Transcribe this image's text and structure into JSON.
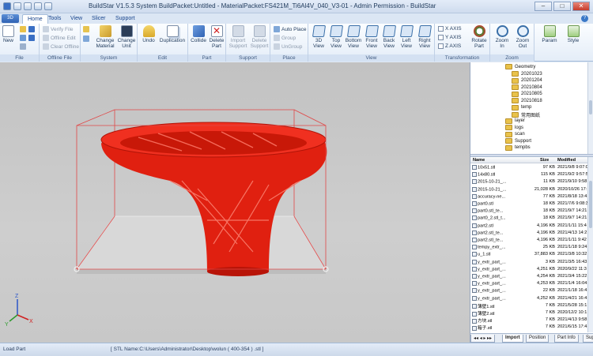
{
  "window": {
    "title": "BuildStar V1.5.3 System    BuildPacket:Untitled - MaterialPacket:FS421M_Ti6Al4V_040_V3-01 - Admin Permission - BuildStar",
    "controls": [
      "–",
      "□",
      "✕"
    ]
  },
  "app_button": "3D",
  "tabs": [
    "Home",
    "Tools",
    "View",
    "Slicer",
    "Support"
  ],
  "help": "?",
  "ribbon": {
    "file": {
      "label": "File",
      "new": "New"
    },
    "offline": {
      "label": "Offline File",
      "verify": "Verify File",
      "edit": "Offline Edit",
      "clear": "Clear Offline"
    },
    "system": {
      "label": "System",
      "change_material": "Change\nMaterial",
      "change_unit": "Change\nUnit"
    },
    "edit": {
      "label": "Edit",
      "undo": "Undo",
      "duplication": "Duplication"
    },
    "part": {
      "label": "Part",
      "collide": "Collide",
      "delete_part": "Delete\nPart"
    },
    "support": {
      "label": "Support",
      "import": "Import\nSupport",
      "delete": "Delete\nSupport"
    },
    "place": {
      "label": "Place",
      "auto": "Auto Place",
      "group": "Group",
      "ungroup": "UnGroup"
    },
    "view": {
      "label": "View",
      "items": [
        "3D\nView",
        "Top\nView",
        "Bottom\nView",
        "Front\nView",
        "Back\nView",
        "Left\nView",
        "Right\nView"
      ]
    },
    "transformation": {
      "label": "Transformation",
      "x_axis": "X AXIS",
      "y_axis": "Y AXIS",
      "z_axis": "Z AXIS",
      "rotate": "Rotate\nPart"
    },
    "zoom": {
      "label": "Zoom",
      "zoom_in": "Zoom\nIn",
      "zoom_out": "Zoom\nOut"
    },
    "param": "Param",
    "style": "Style"
  },
  "tree": {
    "root": "Geometry",
    "children": [
      "20201023",
      "20201204",
      "20210804",
      "20210805",
      "20210818",
      "temp",
      "常用图纸"
    ],
    "siblings": [
      "layer",
      "logs",
      "scan",
      "Support",
      "tempbs"
    ]
  },
  "file_list": {
    "headers": {
      "name": "Name",
      "size": "Size",
      "modified": "Modified"
    },
    "rows": [
      {
        "name": "10x51.stl",
        "size": "97 KB",
        "modified": "2021/9/8 9:07:0"
      },
      {
        "name": "14x80.stl",
        "size": "115 KB",
        "modified": "2021/9/2 9:57:5"
      },
      {
        "name": "2015-10-21_...",
        "size": "11 KB",
        "modified": "2021/9/10 9:58"
      },
      {
        "name": "2015-10-21_...",
        "size": "21,028 KB",
        "modified": "2020/10/26 17:"
      },
      {
        "name": "accuracy-ne...",
        "size": "77 KB",
        "modified": "2021/8/18 13:4"
      },
      {
        "name": "part0.stl",
        "size": "18 KB",
        "modified": "2021/7/6 9:08:3"
      },
      {
        "name": "part0.stl_te...",
        "size": "18 KB",
        "modified": "2021/9/7 14:21"
      },
      {
        "name": "part0_2.stl_t...",
        "size": "18 KB",
        "modified": "2021/9/7 14:21"
      },
      {
        "name": "part2.stl",
        "size": "4,196 KB",
        "modified": "2021/1/11 15:4"
      },
      {
        "name": "part2.stl_te...",
        "size": "4,196 KB",
        "modified": "2021/4/13 14:2"
      },
      {
        "name": "part2.stl_te...",
        "size": "4,196 KB",
        "modified": "2021/1/11 9:42"
      },
      {
        "name": "tempy_extr_...",
        "size": "25 KB",
        "modified": "2021/1/18 9:24"
      },
      {
        "name": "u_1.stl",
        "size": "37,883 KB",
        "modified": "2021/3/8 10:32"
      },
      {
        "name": "y_extr_part_...",
        "size": "3 KB",
        "modified": "2021/3/5 16:43"
      },
      {
        "name": "y_extr_part_...",
        "size": "4,251 KB",
        "modified": "2020/9/22 11:3"
      },
      {
        "name": "y_extr_part_...",
        "size": "4,254 KB",
        "modified": "2021/3/4 15:22"
      },
      {
        "name": "y_extr_part_...",
        "size": "4,253 KB",
        "modified": "2021/1/4 16:04"
      },
      {
        "name": "y_extr_part_...",
        "size": "22 KB",
        "modified": "2021/1/18 16:4"
      },
      {
        "name": "y_extr_part_...",
        "size": "4,252 KB",
        "modified": "2021/4/21 16:4"
      },
      {
        "name": "薄壁1.stl",
        "size": "7 KB",
        "modified": "2021/5/28 15:1"
      },
      {
        "name": "薄壁2.stl",
        "size": "7 KB",
        "modified": "2020/12/2 10:1"
      },
      {
        "name": "方块.stl",
        "size": "7 KB",
        "modified": "2021/4/13 9:58"
      },
      {
        "name": "箱子.stl",
        "size": "7 KB",
        "modified": "2021/6/15 17:4"
      }
    ]
  },
  "bottom_tabs": [
    "Import",
    "Position",
    "Part Info",
    "Sup"
  ],
  "status": {
    "left": "Load Part",
    "right": "[ STL Name:C:\\Users\\Administrator\\Desktop\\wolun ( 400-354 ) .stl ]"
  },
  "axes": {
    "x": "X",
    "y": "Y",
    "z": "Z"
  }
}
